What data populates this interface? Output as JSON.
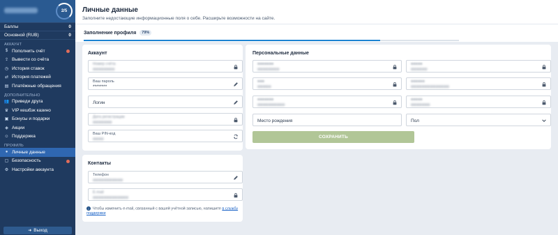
{
  "sidebar": {
    "progress": "2/5",
    "balance": [
      {
        "label": "Баллы",
        "value": "0"
      },
      {
        "label": "Основной (RUB)",
        "value": "0"
      }
    ],
    "sections": [
      {
        "title": "АККАУНТ",
        "items": [
          {
            "label": "Пополнить счёт",
            "icon": "dollar-icon",
            "dot": true
          },
          {
            "label": "Вывести со счёта",
            "icon": "upload-icon",
            "dot": false
          },
          {
            "label": "История ставок",
            "icon": "history-icon",
            "dot": false
          },
          {
            "label": "История платежей",
            "icon": "transfer-icon",
            "dot": false
          },
          {
            "label": "Платёжные обращения",
            "icon": "document-icon",
            "dot": false
          }
        ]
      },
      {
        "title": "ДОПОЛНИТЕЛЬНО",
        "items": [
          {
            "label": "Приведи друга",
            "icon": "users-icon",
            "dot": false
          },
          {
            "label": "VIP кешбэк казино",
            "icon": "crown-icon",
            "dot": false
          },
          {
            "label": "Бонусы и подарки",
            "icon": "gift-icon",
            "dot": false
          },
          {
            "label": "Акции",
            "icon": "tag-icon",
            "dot": false
          },
          {
            "label": "Поддержка",
            "icon": "support-icon",
            "dot": false
          }
        ]
      },
      {
        "title": "ПРОФИЛЬ",
        "items": [
          {
            "label": "Личные данные",
            "icon": "user-icon",
            "dot": false,
            "active": true
          },
          {
            "label": "Безопасность",
            "icon": "lock-icon",
            "dot": true
          },
          {
            "label": "Настройки аккаунта",
            "icon": "gear-icon",
            "dot": false
          }
        ]
      }
    ],
    "logout": "Выход"
  },
  "header": {
    "title": "Личные данные",
    "subtitle": "Заполните недостающие информационные поля о себе. Расширьте возможности на сайте."
  },
  "profile_tab": {
    "label": "Заполнение профиля",
    "percent": "79%",
    "progress": 0.79
  },
  "account": {
    "title": "Аккаунт",
    "fields": [
      {
        "label": "Номер счёта",
        "value": "",
        "icon": "lock-icon"
      },
      {
        "label": "Ваш пароль",
        "value": "********",
        "icon": "pencil-icon"
      },
      {
        "label": "Логин",
        "value": "",
        "icon": "pencil-icon"
      },
      {
        "label": "Дата регистрации",
        "value": "",
        "icon": "lock-icon"
      },
      {
        "label": "Ваш PIN-код",
        "value": "",
        "icon": "refresh-icon"
      }
    ]
  },
  "contacts": {
    "title": "Контакты",
    "phone_label": "Телефон",
    "email_label": "E-mail",
    "note_text": "Чтобы изменить e-mail, связанный с вашей учётной записью, напишите",
    "note_link": "в службу поддержки"
  },
  "personal": {
    "title": "Персональные данные",
    "birthplace_placeholder": "Место рождения",
    "gender_placeholder": "Пол",
    "save_label": "СОХРАНИТЬ"
  }
}
